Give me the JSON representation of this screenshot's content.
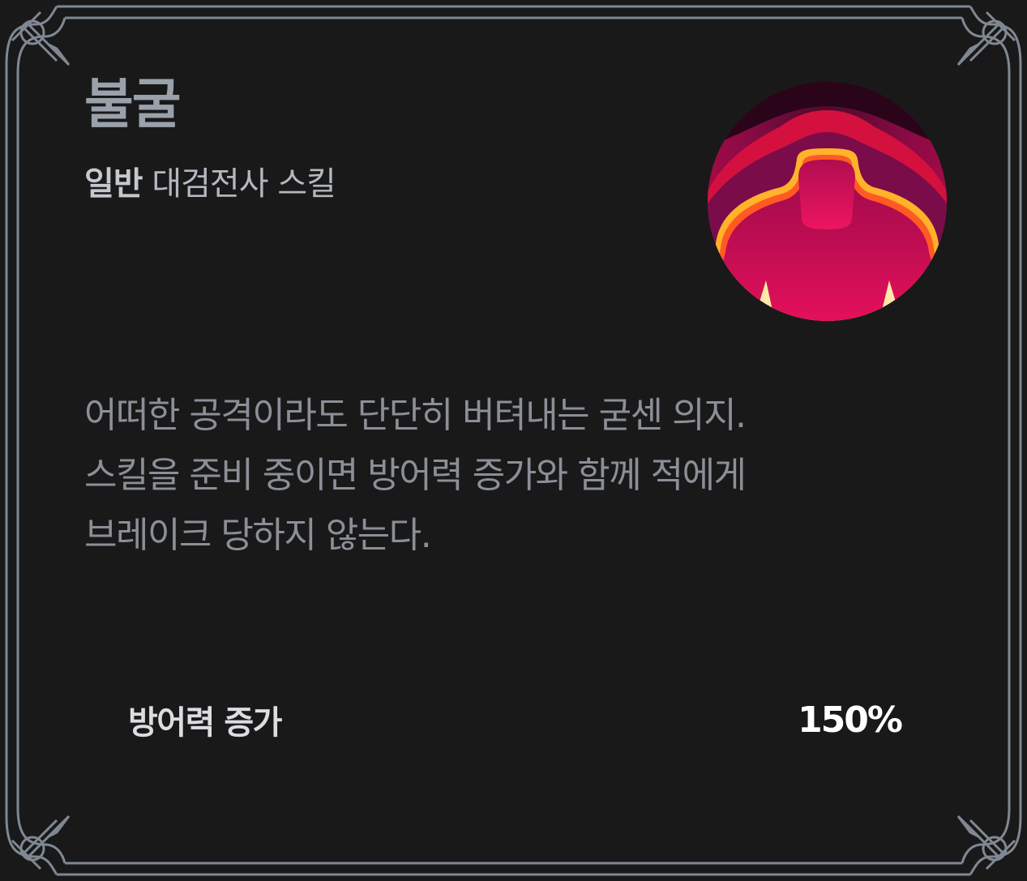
{
  "skill": {
    "name": "불굴",
    "grade": "일반",
    "category": "대검전사 스킬",
    "icon": "fortitude-skill-icon",
    "description_lines": [
      "어떠한 공격이라도 단단히 버텨내는 굳센 의지.",
      "스킬을 준비 중이면 방어력 증가와 함께 적에게",
      "브레이크 당하지 않는다."
    ],
    "stats": [
      {
        "label": "방어력 증가",
        "value": "150%"
      }
    ]
  },
  "colors": {
    "background": "#19191a",
    "frame": "#7f8892",
    "title": "#9aa1ab",
    "stat_value": "#ffffff",
    "icon_primary": "#e0104f",
    "icon_glow": "#ffb22a"
  }
}
